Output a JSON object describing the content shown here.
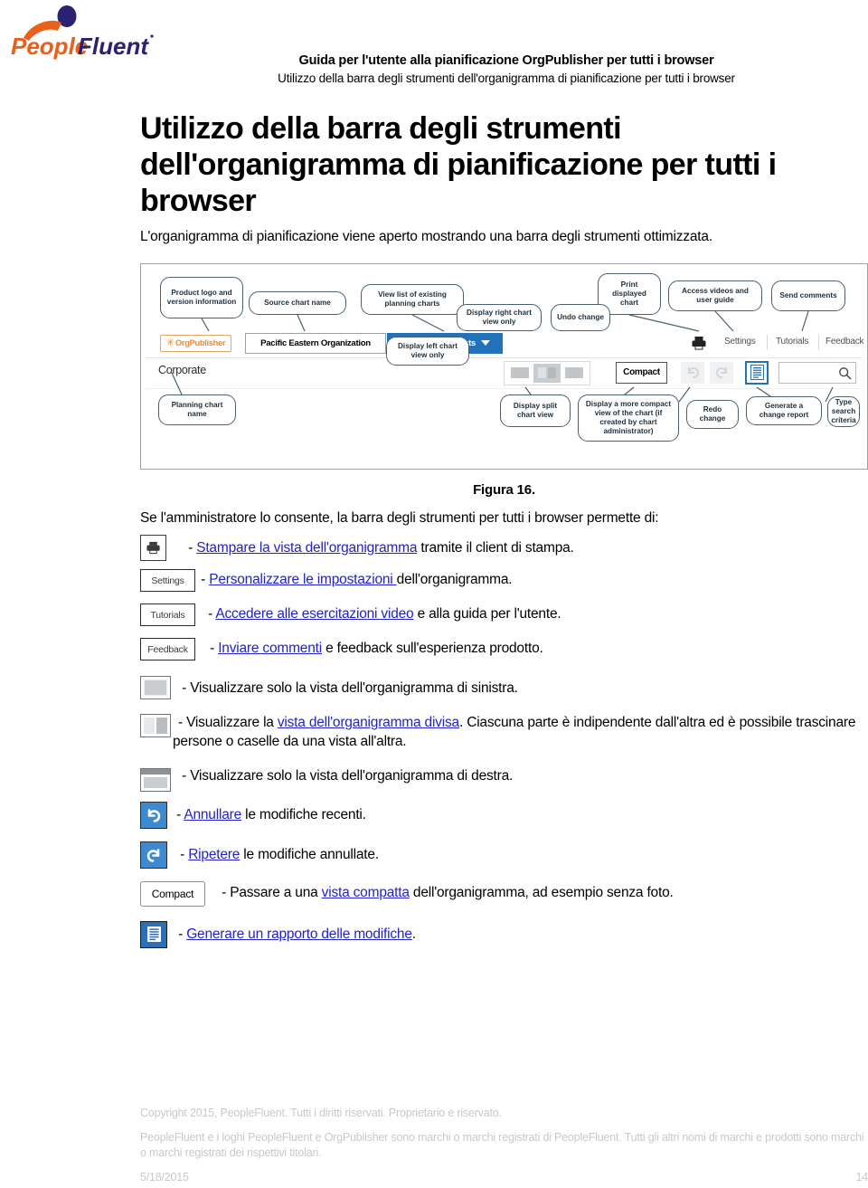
{
  "brand": {
    "logo_name": "peoplefluent-logo",
    "word_people": "People",
    "word_fluent": "Fluent",
    "color_orange": "#E8601C",
    "color_navy": "#2B2171"
  },
  "header": {
    "title_main": "Guida per l'utente alla pianificazione OrgPublisher per tutti i browser",
    "title_sub": "Utilizzo della barra degli strumenti dell'organigramma di pianificazione per tutti i browser"
  },
  "document": {
    "heading": "Utilizzo della barra degli strumenti dell'organigramma di pianificazione per tutti i browser",
    "intro": "L'organigramma di pianificazione viene aperto mostrando una barra degli strumenti ottimizzata.",
    "figure_caption": "Figura 16.",
    "lede": "Se l'amministratore lo consente, la barra degli strumenti per tutti i browser permette di:"
  },
  "figure": {
    "callouts": [
      "Product logo and version information",
      "Source chart name",
      "View list of existing planning charts",
      "Print displayed chart",
      "Access videos and user guide",
      "Send comments",
      "Display right chart view only",
      "Undo change",
      "Planning chart name",
      "Display left chart view only",
      "Display split chart view",
      "Display a more compact view of the chart (if created by chart administrator)",
      "Redo change",
      "Generate a change report",
      "Type search criteria"
    ],
    "toolbar": {
      "product_badge": "OrgPublisher",
      "source_chart_name": "Pacific Eastern Organization",
      "planning_charts_button": "My Planning Charts",
      "settings": "Settings",
      "tutorials": "Tutorials",
      "feedback": "Feedback",
      "planning_chart_name": "Corporate",
      "compact": "Compact",
      "search_placeholder": ""
    },
    "accent_blue": "#2272B9"
  },
  "bullets": [
    {
      "icon": "print-icon",
      "icon_label": "",
      "dash": "- ",
      "link": "Stampare la vista dell'organigramma",
      "after": " tramite il client di stampa."
    },
    {
      "icon": "settings-button-icon",
      "icon_label": "Settings",
      "dash": "- ",
      "link": "Personalizzare le impostazioni ",
      "after": " dell'organigramma."
    },
    {
      "icon": "tutorials-button-icon",
      "icon_label": "Tutorials",
      "dash": "- ",
      "link": "Accedere alle esercitazioni video",
      "after": " e alla guida per l'utente."
    },
    {
      "icon": "feedback-button-icon",
      "icon_label": "Feedback",
      "dash": "- ",
      "link": "Inviare commenti",
      "after": " e feedback sull'esperienza prodotto."
    },
    {
      "icon": "left-view-icon",
      "icon_label": "",
      "dash": "- ",
      "link": "",
      "after": "Visualizzare solo la vista dell'organigramma di sinistra."
    },
    {
      "icon": "split-view-icon",
      "icon_label": "",
      "dash": "- ",
      "before": "Visualizzare la ",
      "link": "vista dell'organigramma divisa",
      "after": ". Ciascuna parte è indipendente dall'altra ed è possibile trascinare persone o caselle da una vista all'altra."
    },
    {
      "icon": "right-view-icon",
      "icon_label": "",
      "dash": "- ",
      "link": "",
      "after": "Visualizzare solo la vista dell'organigramma di destra."
    },
    {
      "icon": "undo-icon",
      "icon_label": "",
      "dash": "- ",
      "link": "Annullare",
      "after": " le modifiche recenti."
    },
    {
      "icon": "redo-icon",
      "icon_label": "",
      "dash": "- ",
      "link": "Ripetere",
      "after": " le modifiche annullate."
    },
    {
      "icon": "compact-button-icon",
      "icon_label": "Compact",
      "dash": "- ",
      "before": "Passare a una ",
      "link": "vista compatta",
      "after": " dell'organigramma, ad esempio senza foto."
    },
    {
      "icon": "change-report-icon",
      "icon_label": "",
      "dash": "- ",
      "link": "Generare un rapporto delle modifiche",
      "after": "."
    }
  ],
  "footer": {
    "copyright": "Copyright 2015, PeopleFluent. Tutti i diritti riservati. Proprietario e riservato.",
    "trademarks": "PeopleFluent e i loghi PeopleFluent e OrgPublisher sono marchi o marchi registrati di PeopleFluent. Tutti gli altri nomi di marchi e prodotti sono marchi o marchi registrati dei rispettivi titolari.",
    "date": "5/18/2015",
    "page_number": "14"
  }
}
